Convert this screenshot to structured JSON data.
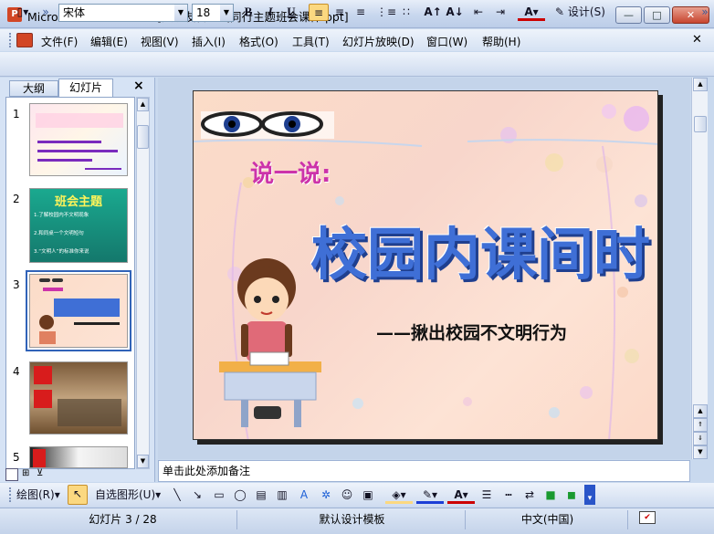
{
  "window": {
    "title": "Microsoft PowerPoint - [文明友善你我同行主题班会课件.ppt]",
    "app_icon": "P",
    "min_label": "—",
    "max_label": "□",
    "close_label": "✕"
  },
  "menu": {
    "items": [
      "文件(F)",
      "编辑(E)",
      "视图(V)",
      "插入(I)",
      "格式(O)",
      "工具(T)",
      "幻灯片放映(D)",
      "窗口(W)",
      "帮助(H)"
    ]
  },
  "toolbar": {
    "font_name": "宋体",
    "font_size": "18",
    "bold": "B",
    "italic": "I",
    "underline": "U",
    "font_color_label": "A",
    "design_label": "设计(S)"
  },
  "panel": {
    "tab_outline": "大纲",
    "tab_slides": "幻灯片",
    "close": "×",
    "slide_numbers": [
      "1",
      "2",
      "3",
      "4",
      "5"
    ],
    "thumb2_title": "班会主题",
    "thumb2_line1": "1.了解校园内不文明现象",
    "thumb2_line2": "2.和同桌一个文明短句",
    "thumb2_line3": "3.“文明人”的标准你来说"
  },
  "slide": {
    "speaker": "说一说:",
    "title": "校园内课间时",
    "subtitle": "——揪出校园不文明行为"
  },
  "notes": {
    "placeholder": "单击此处添加备注"
  },
  "drawbar": {
    "draw_label": "绘图(R)",
    "autoshapes_label": "自选图形(U)"
  },
  "status": {
    "slide_info": "幻灯片 3 / 28",
    "template": "默认设计模板",
    "language": "中文(中国)"
  },
  "colors": {
    "slide_title": "#3f6fd6",
    "speaker": "#cc33aa",
    "accent": "#fbd880"
  }
}
